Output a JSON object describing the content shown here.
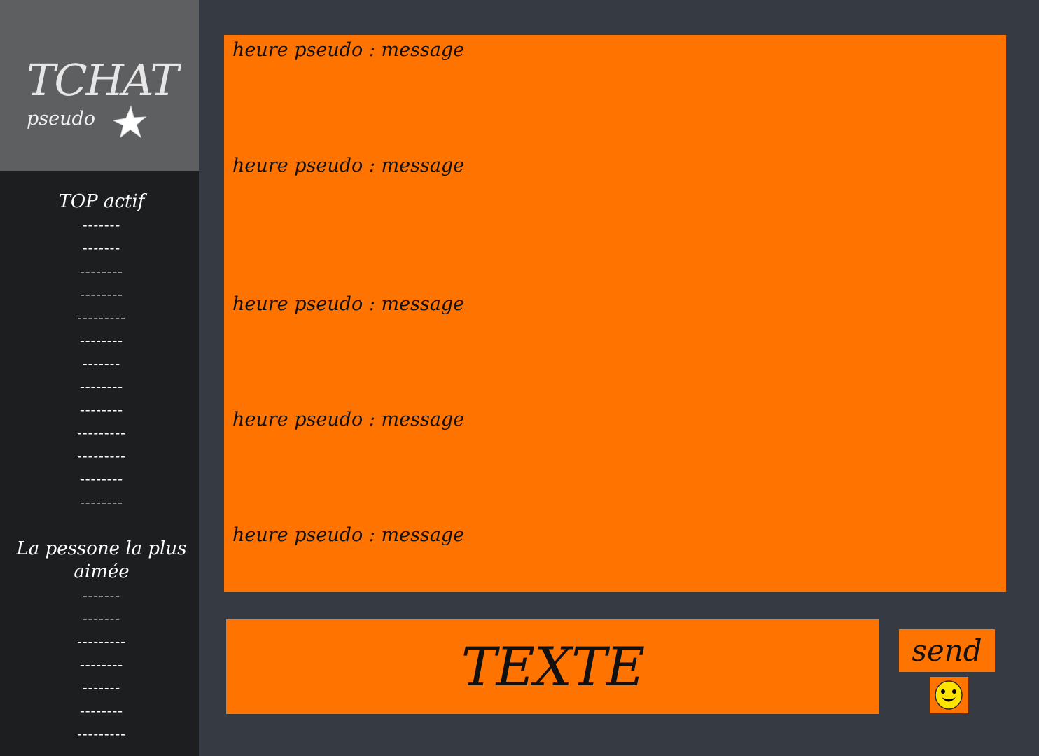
{
  "sidebar": {
    "title": "TCHAT",
    "pseudo_label": "pseudo",
    "favorite_icon": "star-icon",
    "sections": [
      {
        "heading": "TOP actif",
        "items": [
          "-------",
          "-------",
          "--------",
          "--------",
          "---------",
          "--------",
          "-------",
          "--------",
          "--------",
          "---------",
          "---------",
          "--------",
          "--------"
        ]
      },
      {
        "heading": "La pessone la plus aimée",
        "items": [
          "-------",
          "-------",
          "---------",
          "--------",
          "-------",
          "--------",
          "---------"
        ]
      }
    ]
  },
  "messages": [
    {
      "text": "heure pseudo : message"
    },
    {
      "text": "heure pseudo : message"
    },
    {
      "text": "heure pseudo : message"
    },
    {
      "text": "heure pseudo : message"
    },
    {
      "text": "heure pseudo : message"
    }
  ],
  "composer": {
    "input_value": "TEXTE",
    "send_label": "send",
    "emoji_icon": "smiley-icon"
  },
  "colors": {
    "accent": "#ff7300",
    "background": "#363a43",
    "sidebar_top": "#5e5f61",
    "sidebar_bottom": "#1c1e1f",
    "smiley": "#ffe400"
  }
}
